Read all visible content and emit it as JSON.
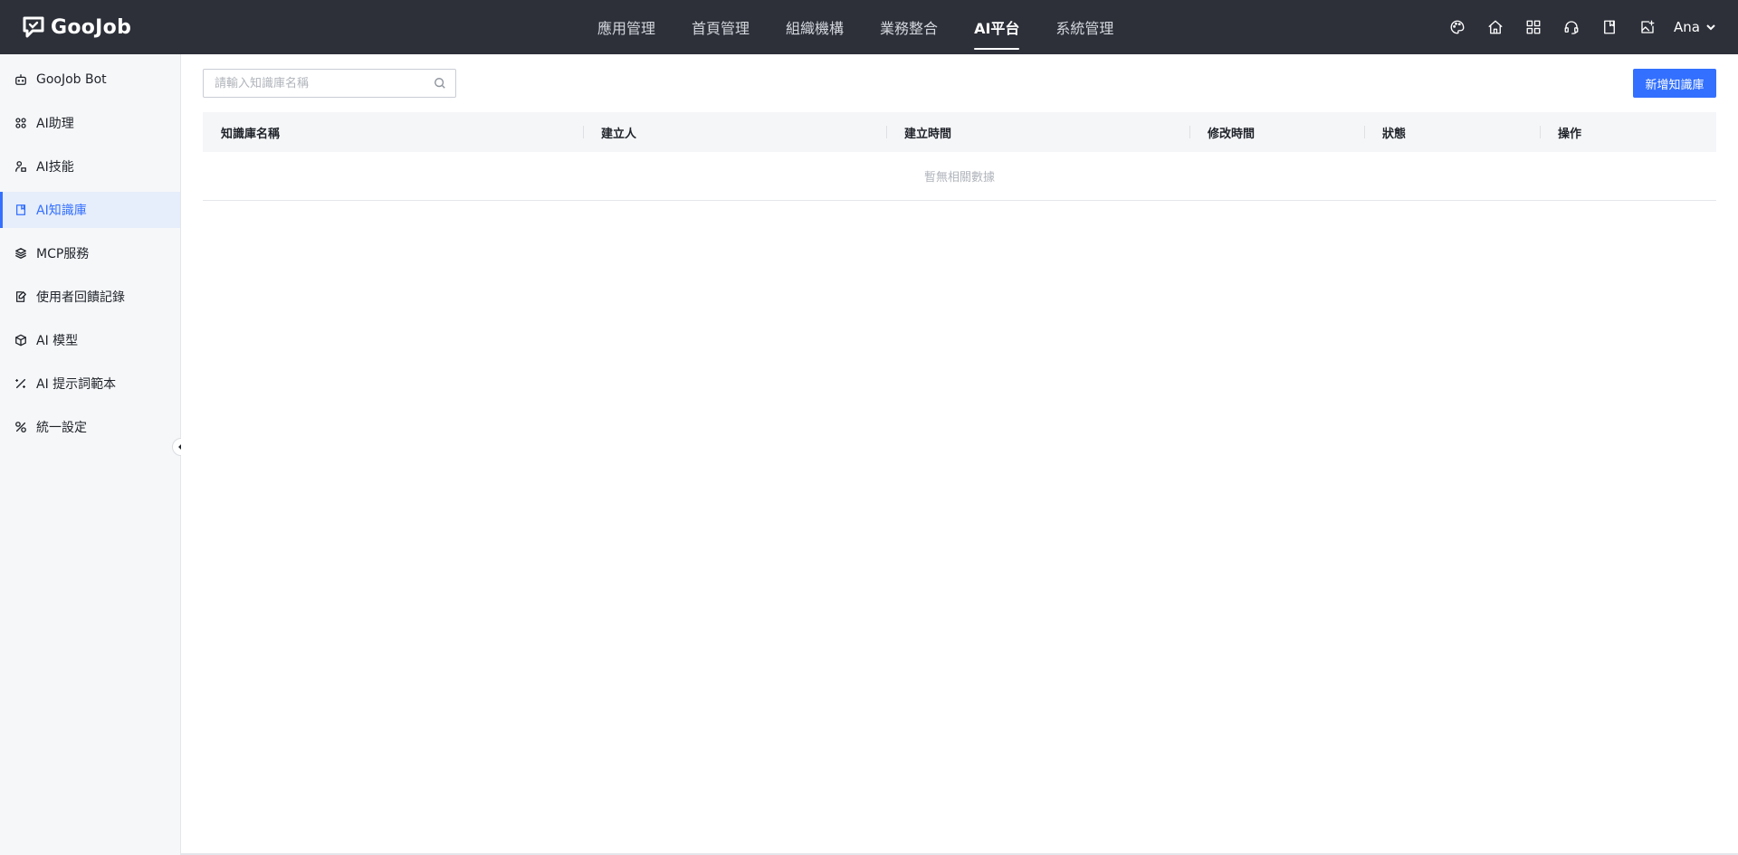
{
  "brand": {
    "name": "GooJob"
  },
  "topnav": {
    "items": [
      {
        "label": "應用管理",
        "active": false
      },
      {
        "label": "首頁管理",
        "active": false
      },
      {
        "label": "組織機構",
        "active": false
      },
      {
        "label": "業務整合",
        "active": false
      },
      {
        "label": "AI平台",
        "active": true
      },
      {
        "label": "系統管理",
        "active": false
      }
    ]
  },
  "header_icons": [
    "palette-icon",
    "home-icon",
    "apps-grid-icon",
    "support-headset-icon",
    "book-icon",
    "image-add-icon"
  ],
  "user": {
    "name": "Ana"
  },
  "sidebar": {
    "items": [
      {
        "label": "GooJob Bot",
        "icon": "robot-icon",
        "active": false
      },
      {
        "label": "AI助理",
        "icon": "grid-dots-icon",
        "active": false
      },
      {
        "label": "AI技能",
        "icon": "skill-icon",
        "active": false
      },
      {
        "label": "AI知識庫",
        "icon": "document-icon",
        "active": true
      },
      {
        "label": "MCP服務",
        "icon": "layers-icon",
        "active": false
      },
      {
        "label": "使用者回饋記錄",
        "icon": "feedback-edit-icon",
        "active": false
      },
      {
        "label": "AI 模型",
        "icon": "cube-icon",
        "active": false
      },
      {
        "label": "AI 提示詞範本",
        "icon": "magic-wand-icon",
        "active": false
      },
      {
        "label": "統一設定",
        "icon": "tools-icon",
        "active": false
      }
    ]
  },
  "search": {
    "placeholder": "請輸入知識庫名稱",
    "value": ""
  },
  "actions": {
    "add_label": "新增知識庫"
  },
  "table": {
    "columns": [
      "知識庫名稱",
      "建立人",
      "建立時間",
      "修改時間",
      "狀態",
      "操作"
    ],
    "rows": [],
    "empty_text": "暫無相關數據"
  },
  "colors": {
    "topbar": "#2d3039",
    "primary": "#3370ff",
    "sidebar_bg": "#f6f7f9",
    "active_bg": "#e6edfb"
  }
}
